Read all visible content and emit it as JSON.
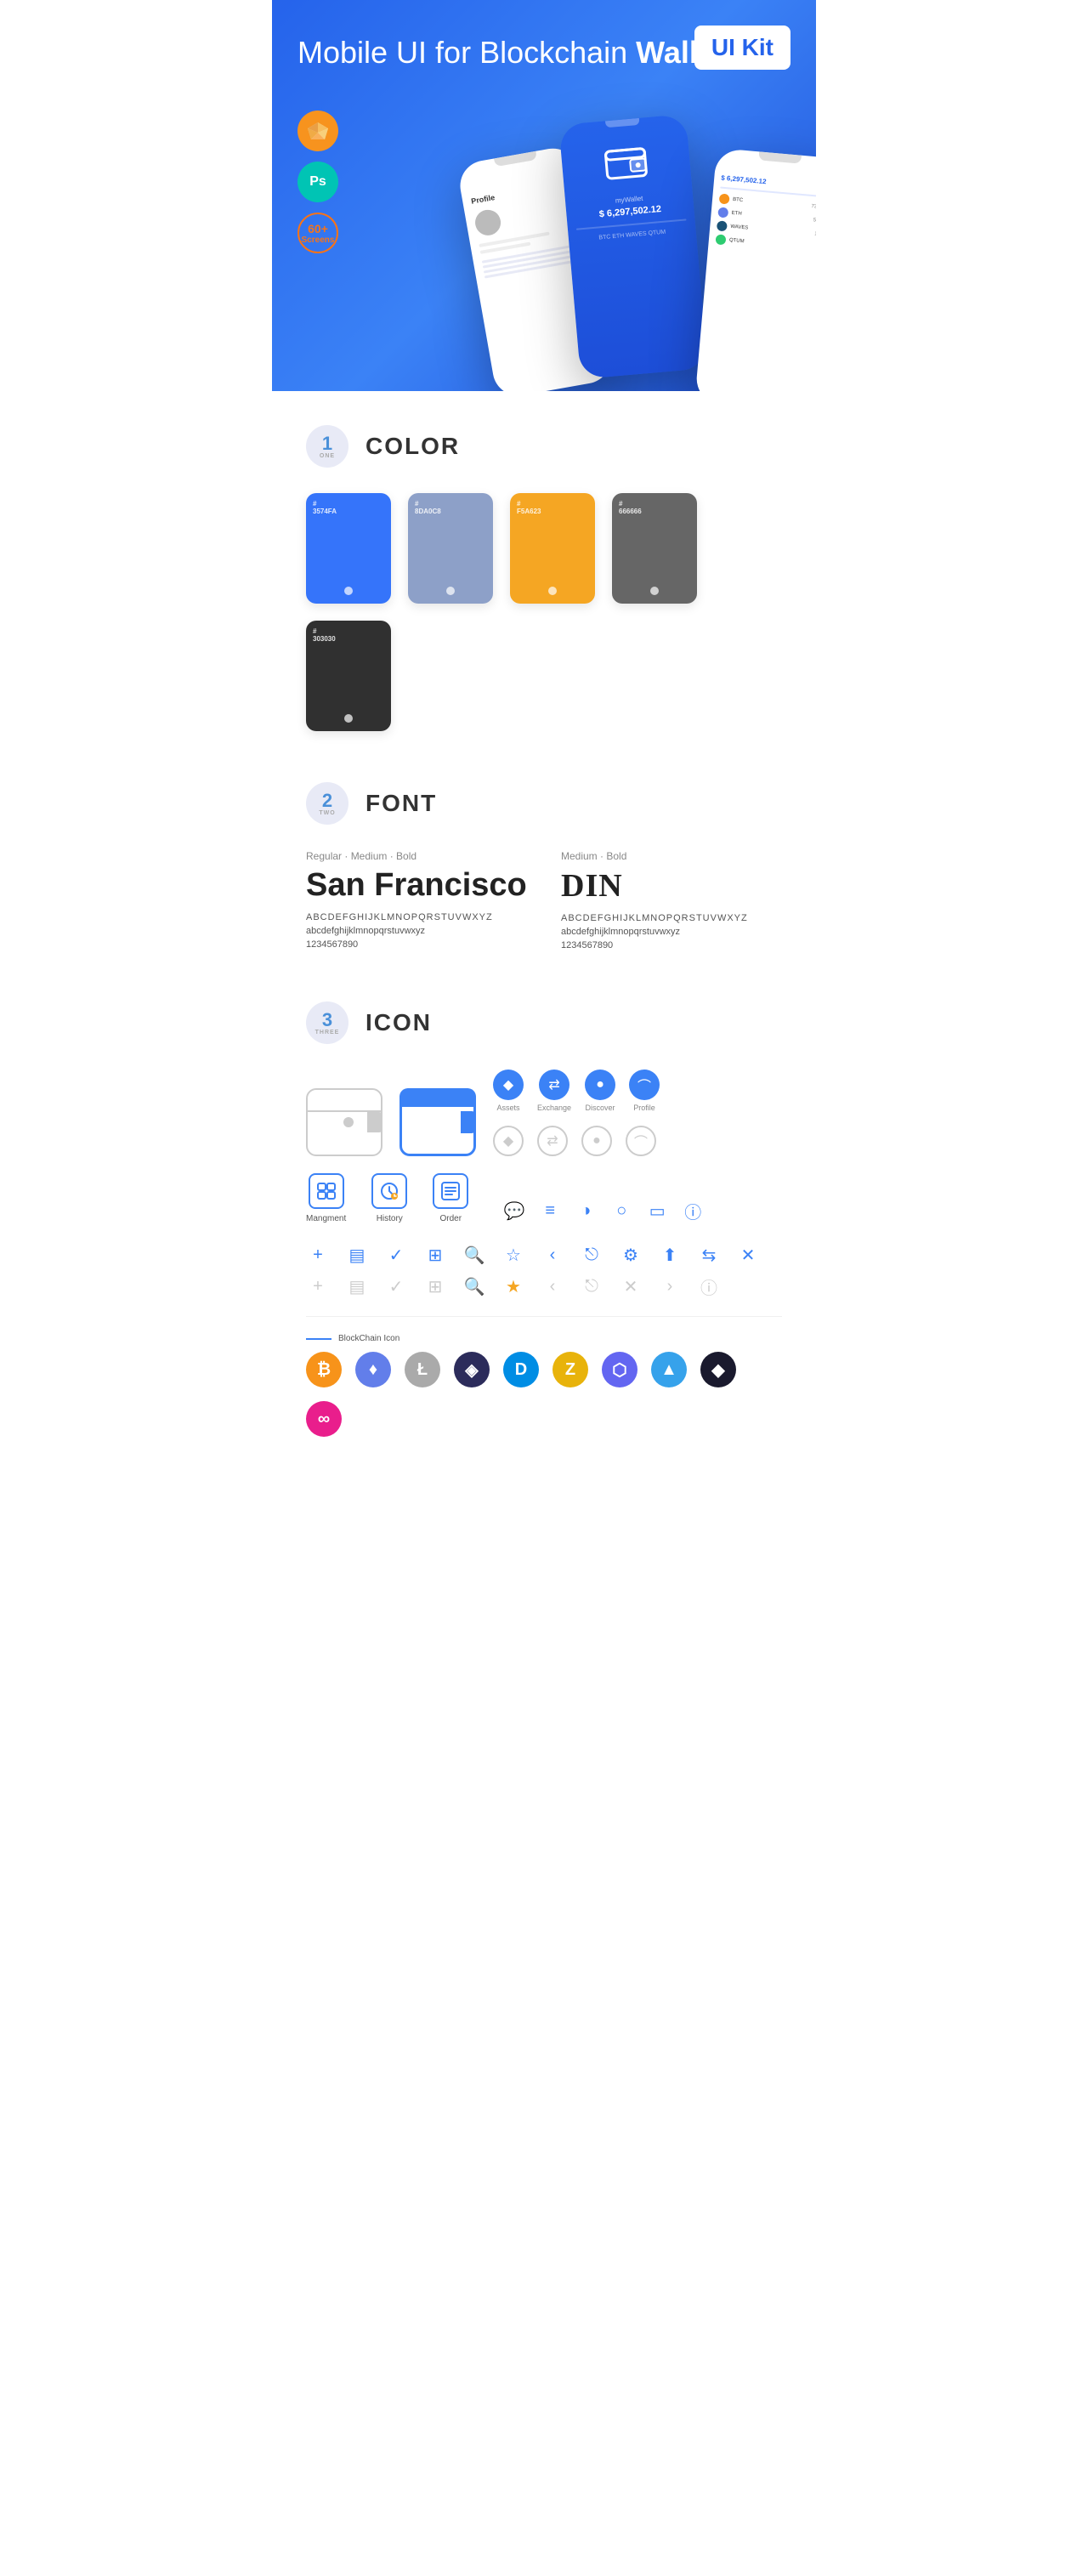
{
  "hero": {
    "title": "Mobile UI for Blockchain ",
    "title_bold": "Wallet",
    "badge": "UI Kit",
    "sketch_label": "Sk",
    "ps_label": "Ps",
    "screens_num": "60+",
    "screens_label": "Screens"
  },
  "sections": {
    "color": {
      "number": "1",
      "sub": "ONE",
      "title": "COLOR",
      "swatches": [
        {
          "hex": "#3574FA",
          "label": "#3574FA",
          "bg": "#3574FA"
        },
        {
          "hex": "#8DA0C8",
          "label": "#8DA0C8",
          "bg": "#8DA0C8"
        },
        {
          "hex": "#F5A623",
          "label": "#F5A623",
          "bg": "#F5A623"
        },
        {
          "hex": "#666666",
          "label": "#666666",
          "bg": "#666666"
        },
        {
          "hex": "#303030",
          "label": "#303030",
          "bg": "#303030"
        }
      ]
    },
    "font": {
      "number": "2",
      "sub": "TWO",
      "title": "FONT",
      "font1": {
        "style": "Regular · Medium · Bold",
        "name": "San Francisco",
        "upper": "ABCDEFGHIJKLMNOPQRSTUVWXYZ",
        "lower": "abcdefghijklmnopqrstuvwxyz",
        "nums": "1234567890"
      },
      "font2": {
        "style": "Medium · Bold",
        "name": "DIN",
        "upper": "ABCDEFGHIJKLMNOPQRSTUVWXYZ",
        "lower": "abcdefghijklmnopqrstuvwxyz",
        "nums": "1234567890"
      }
    },
    "icon": {
      "number": "3",
      "sub": "THREE",
      "title": "ICON",
      "nav_icons": [
        {
          "label": "Mangment",
          "icon": "nav-management"
        },
        {
          "label": "History",
          "icon": "nav-history"
        },
        {
          "label": "Order",
          "icon": "nav-order"
        }
      ],
      "circle_icons": [
        {
          "label": "Assets",
          "icon": "◆"
        },
        {
          "label": "Exchange",
          "icon": "⇄"
        },
        {
          "label": "Discover",
          "icon": "●"
        },
        {
          "label": "Profile",
          "icon": "⌒"
        }
      ],
      "blockchain_label": "BlockChain Icon",
      "crypto_icons": [
        {
          "symbol": "₿",
          "color": "#f7931a",
          "bg": "#fff3e0",
          "name": "bitcoin"
        },
        {
          "symbol": "◎",
          "color": "#627eea",
          "bg": "#ede9fe",
          "name": "ethereum"
        },
        {
          "symbol": "Ł",
          "color": "#bfbfbf",
          "bg": "#f5f5f5",
          "name": "litecoin"
        },
        {
          "symbol": "◈",
          "color": "#2c2c5b",
          "bg": "#e8e8f5",
          "name": "unknown1"
        },
        {
          "symbol": "D",
          "color": "#008de4",
          "bg": "#e0f2ff",
          "name": "dash"
        },
        {
          "symbol": "Z",
          "color": "#e8b30b",
          "bg": "#fdf6dc",
          "name": "zcash"
        },
        {
          "symbol": "⬡",
          "color": "#8b5cf6",
          "bg": "#ede9fe",
          "name": "polygon"
        },
        {
          "symbol": "▲",
          "color": "#36a2eb",
          "bg": "#e0f2ff",
          "name": "arweave"
        },
        {
          "symbol": "◆",
          "color": "#4ade80",
          "bg": "#dcfce7",
          "name": "unknown2"
        },
        {
          "symbol": "∞",
          "color": "#ec4899",
          "bg": "#fce7f3",
          "name": "unknown3"
        }
      ]
    }
  }
}
